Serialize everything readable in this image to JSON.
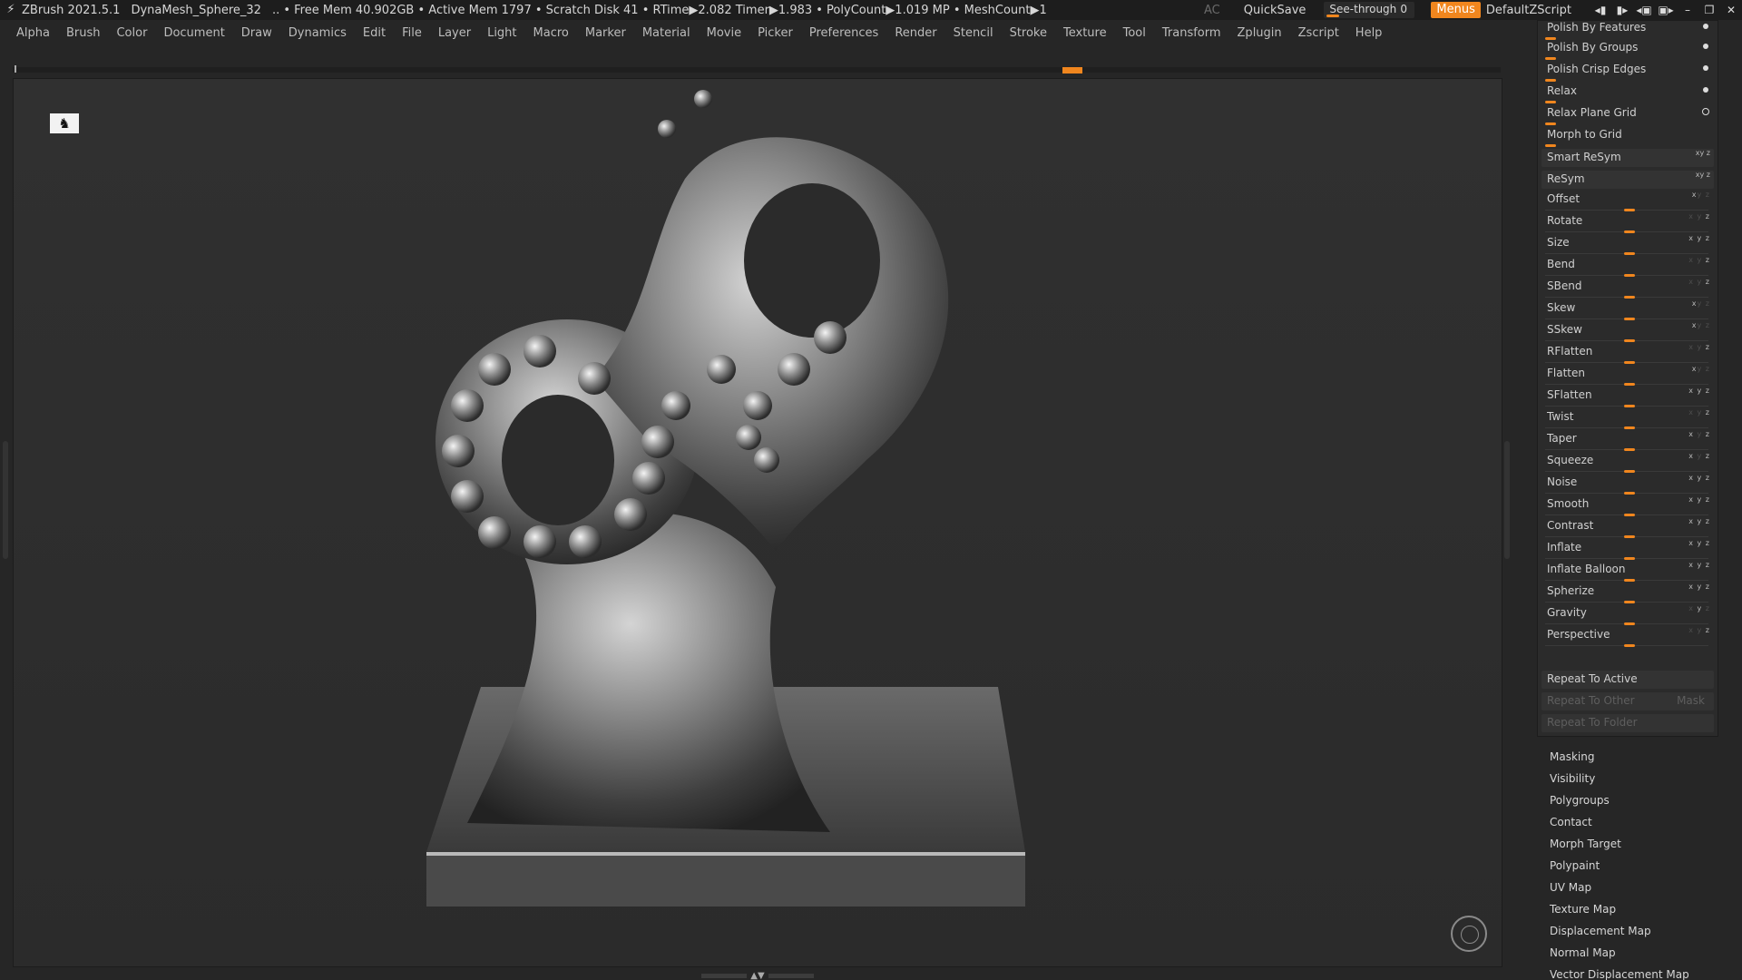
{
  "titlebar": {
    "app": "ZBrush 2021.5.1",
    "document": "DynaMesh_Sphere_32",
    "status": ".. • Free Mem 40.902GB • Active Mem 1797 • Scratch Disk 41 •  RTime▶2.082 Timer▶1.983 • PolyCount▶1.019 MP  • MeshCount▶1",
    "ac": "AC",
    "quicksave": "QuickSave",
    "seethrough_label": "See-through",
    "seethrough_value": "0",
    "menus": "Menus",
    "script": "DefaultZScript"
  },
  "menubar": [
    "Alpha",
    "Brush",
    "Color",
    "Document",
    "Draw",
    "Dynamics",
    "Edit",
    "File",
    "Layer",
    "Light",
    "Macro",
    "Marker",
    "Material",
    "Movie",
    "Picker",
    "Preferences",
    "Render",
    "Stencil",
    "Stroke",
    "Texture",
    "Tool",
    "Transform",
    "Zplugin",
    "Zscript",
    "Help"
  ],
  "panel": {
    "polish_by_features": "Polish By Features",
    "polish_by_groups": "Polish By Groups",
    "polish_crisp_edges": "Polish Crisp Edges",
    "relax": "Relax",
    "relax_plane_grid": "Relax Plane Grid",
    "morph_to_grid": "Morph to Grid",
    "smart_resym": "Smart ReSym",
    "resym": "ReSym",
    "deformations": [
      "Offset",
      "Rotate",
      "Size",
      "Bend",
      "SBend",
      "Skew",
      "SSkew",
      "RFlatten",
      "Flatten",
      "SFlatten",
      "Twist",
      "Taper",
      "Squeeze",
      "Noise",
      "Smooth",
      "Contrast",
      "Inflate",
      "Inflate Balloon",
      "Spherize",
      "Gravity",
      "Perspective"
    ],
    "repeat_to_active": "Repeat To Active",
    "repeat_to_other": "Repeat To Other",
    "mask": "Mask",
    "repeat_to_folder": "Repeat To Folder"
  },
  "sublist": [
    "Masking",
    "Visibility",
    "Polygroups",
    "Contact",
    "Morph Target",
    "Polypaint",
    "UV Map",
    "Texture Map",
    "Displacement Map",
    "Normal Map",
    "Vector Displacement Map"
  ],
  "colors": {
    "accent": "#f0861e",
    "panel_bg": "#2b2b2b",
    "viewport_bg": "#2e2e2e"
  }
}
